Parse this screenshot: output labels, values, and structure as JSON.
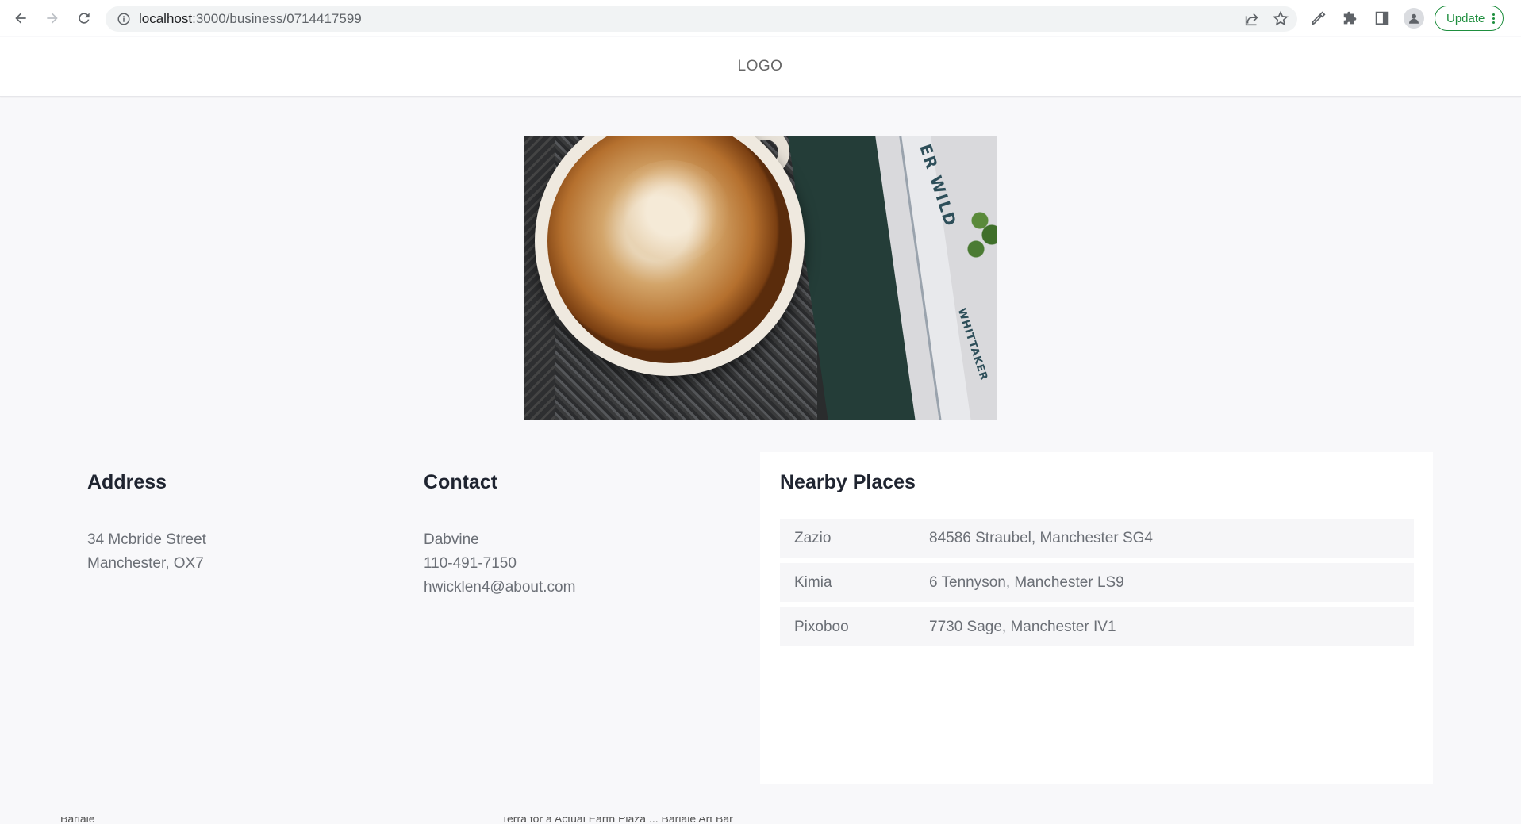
{
  "browser": {
    "url_host": "localhost",
    "url_path": ":3000/business/0714417599",
    "update_label": "Update",
    "icons": [
      "back-icon",
      "forward-icon",
      "reload-icon",
      "info-icon",
      "share-icon",
      "star-icon",
      "eyedropper-icon",
      "extensions-icon",
      "sidepanel-icon",
      "profile-icon",
      "kebab-menu-icon"
    ]
  },
  "header": {
    "logo": "LOGO"
  },
  "hero": {
    "book_text_1": "ER WILD",
    "book_text_2": "WHITTAKER"
  },
  "address": {
    "title": "Address",
    "line1": "34 Mcbride Street",
    "line2": "Manchester, OX7"
  },
  "contact": {
    "title": "Contact",
    "name": "Dabvine",
    "phone": "110-491-7150",
    "email": "hwicklen4@about.com"
  },
  "nearby": {
    "title": "Nearby Places",
    "places": [
      {
        "name": "Zazio",
        "address": "84586 Straubel, Manchester SG4"
      },
      {
        "name": "Kimia",
        "address": "6 Tennyson, Manchester LS9"
      },
      {
        "name": "Pixoboo",
        "address": "7730 Sage, Manchester IV1"
      }
    ]
  },
  "footer": {
    "left": "Bariale",
    "right": "Terra for a Actual Earth Plaza ... Bariale Art Bar"
  },
  "colors": {
    "update_green": "#1e8e3e",
    "heading": "#1f2430",
    "body_text": "#6b6f76",
    "page_bg": "#f8f8fa"
  }
}
